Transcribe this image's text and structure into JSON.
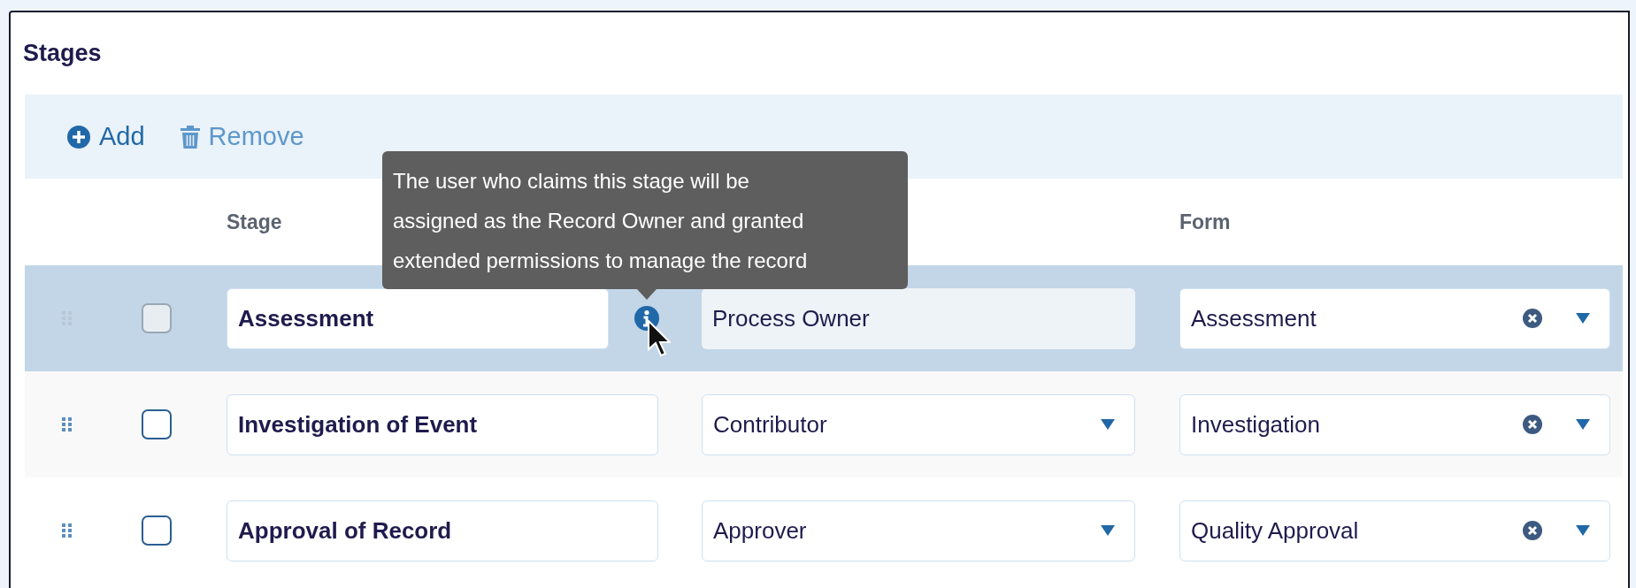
{
  "section_title": "Stages",
  "toolbar": [
    {
      "kind": "add",
      "label": "Add",
      "disabled": false
    },
    {
      "kind": "remove",
      "label": "Remove",
      "disabled": true
    }
  ],
  "table": {
    "columns": {
      "stage": "Stage",
      "form": "Form"
    },
    "rows": [
      {
        "selected": true,
        "checked": false,
        "checkbox_disabled": true,
        "stage": "Assessment",
        "info": true,
        "role": {
          "value": "Process Owner",
          "disabled": true
        },
        "form": "Assessment"
      },
      {
        "selected": false,
        "checked": false,
        "checkbox_disabled": false,
        "stage": "Investigation of Event",
        "info": false,
        "role": {
          "value": "Contributor",
          "disabled": false
        },
        "form": "Investigation"
      },
      {
        "selected": false,
        "checked": false,
        "checkbox_disabled": false,
        "stage": "Approval of Record",
        "info": false,
        "role": {
          "value": "Approver",
          "disabled": false
        },
        "form": "Quality Approval"
      }
    ]
  },
  "tooltip": {
    "text": "The user who claims this stage will be assigned as the Record Owner and granted extended permissions to manage the record"
  }
}
